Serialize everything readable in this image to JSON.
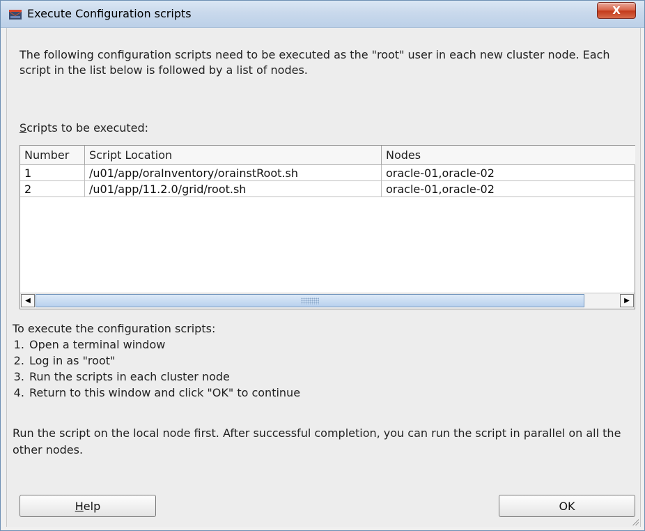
{
  "window": {
    "title": "Execute Configuration scripts",
    "close_glyph": "X",
    "icon": "oracle-installer-icon"
  },
  "intro_text": "The following configuration scripts need to be executed as the \"root\" user in each new cluster node. Each script in the list below is followed by a list of nodes.",
  "scripts_label": {
    "mnemonic": "S",
    "rest": "cripts to be executed:"
  },
  "table": {
    "columns": [
      "Number",
      "Script Location",
      "Nodes"
    ],
    "rows": [
      [
        "1",
        "/u01/app/oraInventory/orainstRoot.sh",
        "oracle-01,oracle-02"
      ],
      [
        "2",
        "/u01/app/11.2.0/grid/root.sh",
        "oracle-01,oracle-02"
      ]
    ],
    "scroll_left_glyph": "◀",
    "scroll_right_glyph": "▶"
  },
  "instructions": {
    "heading": "To execute the configuration scripts:",
    "steps": [
      "Open a terminal window",
      "Log in as \"root\"",
      "Run the scripts in each cluster node",
      "Return to this window and click \"OK\" to continue"
    ]
  },
  "note": "Run the script on the local node first. After successful completion, you can run the script in parallel on all the other nodes.",
  "buttons": {
    "help_mnemonic": "H",
    "help_rest": "elp",
    "ok": "OK"
  },
  "colors": {
    "titlebar": "#c9d9ec",
    "close_button": "#c43b1c",
    "scroll_thumb": "#b9d1ee"
  }
}
